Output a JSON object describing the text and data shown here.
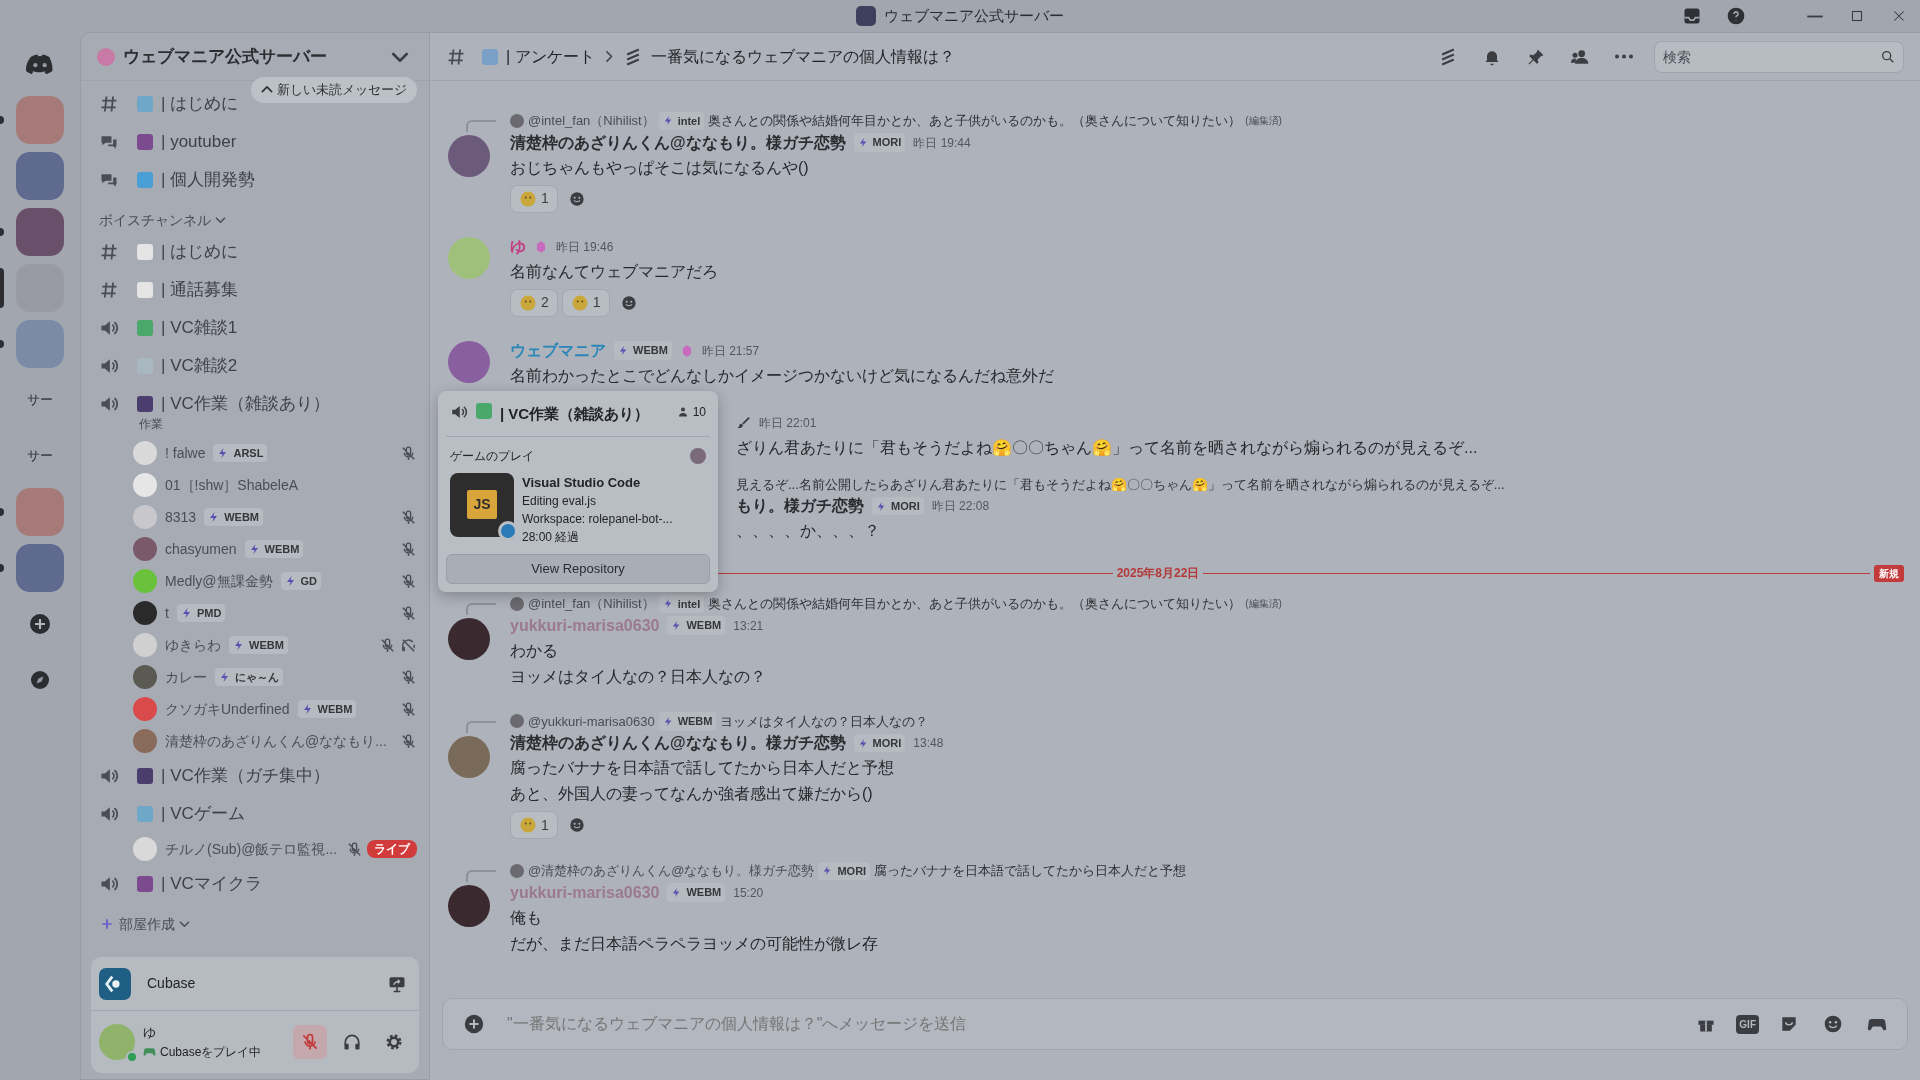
{
  "window": {
    "title": "ウェブマニア公式サーバー"
  },
  "servers": [
    {
      "kind": "home",
      "unread": false,
      "selected": false
    },
    {
      "kind": "guild",
      "unread": true,
      "selected": false
    },
    {
      "kind": "guild",
      "unread": false,
      "selected": false
    },
    {
      "kind": "guild",
      "unread": true,
      "selected": false
    },
    {
      "kind": "guild",
      "unread": false,
      "selected": true
    },
    {
      "kind": "guild",
      "unread": true,
      "selected": false
    },
    {
      "kind": "named",
      "label": "サー",
      "unread": false,
      "selected": false
    },
    {
      "kind": "named",
      "label": "サー",
      "unread": false,
      "selected": false
    },
    {
      "kind": "guild",
      "unread": true,
      "selected": false
    },
    {
      "kind": "guild",
      "unread": true,
      "selected": false
    },
    {
      "kind": "add",
      "unread": false,
      "selected": false
    },
    {
      "kind": "discover",
      "unread": false,
      "selected": false
    }
  ],
  "server": {
    "name": "ウェブマニア公式サーバー"
  },
  "unread_banner": "新しい未読メッセージ",
  "channels": [
    {
      "kind": "text",
      "name": "| はじめに"
    },
    {
      "kind": "forum",
      "name": "| youtuber"
    },
    {
      "kind": "forum",
      "name": "| 個人開発勢"
    },
    {
      "kind": "category",
      "name": "ボイスチャンネル",
      "expanded": true
    },
    {
      "kind": "text",
      "name": "| はじめに"
    },
    {
      "kind": "text",
      "name": "| 通話募集"
    },
    {
      "kind": "voice",
      "name": "| VC雑談1"
    },
    {
      "kind": "voice",
      "name": "| VC雑談2"
    },
    {
      "kind": "voice",
      "name": "| VC作業（雑談あり）",
      "status": "作業",
      "members": [
        {
          "name": "! falwe",
          "tag": "ARSL",
          "muted": true,
          "deafened": false
        },
        {
          "name": "01［!shw］ShabeleA",
          "muted": false,
          "deafened": false
        },
        {
          "name": "8313",
          "tag": "WEBM",
          "muted": true,
          "deafened": false
        },
        {
          "name": "chasyumen",
          "tag": "WEBM",
          "muted": true,
          "deafened": false
        },
        {
          "name": "Medly@無課金勢",
          "tag": "GD",
          "muted": true,
          "deafened": false
        },
        {
          "name": "t",
          "tag": "PMD",
          "muted": true,
          "deafened": false
        },
        {
          "name": "ゆきらわ",
          "tag": "WEBM",
          "muted": true,
          "deafened": true
        },
        {
          "name": "カレー",
          "tag": "にゃ～ん",
          "muted": true,
          "deafened": false
        },
        {
          "name": "クソガキUnderfined",
          "tag": "WEBM",
          "muted": true,
          "deafened": false
        },
        {
          "name": "清楚枠のあざりんくん@ななもり...",
          "muted": true,
          "deafened": false
        }
      ]
    },
    {
      "kind": "voice",
      "name": "| VC作業（ガチ集中）"
    },
    {
      "kind": "voice",
      "name": "| VCゲーム",
      "members": [
        {
          "name": "チルノ(Sub)@飯テロ監視...",
          "muted": true,
          "deafened": false,
          "live": "ライブ"
        }
      ]
    },
    {
      "kind": "voice",
      "name": "| VCマイクラ"
    },
    {
      "kind": "create",
      "name": "部屋作成",
      "expanded": true
    }
  ],
  "activity": {
    "name": "Cubase"
  },
  "user": {
    "name": "ゆ",
    "status": "Cubaseをプレイ中",
    "online": true,
    "muted": true,
    "deafened": false
  },
  "header": {
    "channel": "| アンケート",
    "thread": "一番気になるウェブマニアの個人情報は？",
    "search": {
      "placeholder": "検索"
    }
  },
  "messages": [
    {
      "kind": "normal",
      "reply": {
        "author": "@intel_fan（Nihilist）",
        "tag": "intel",
        "text": "奥さんとの関係や結婚何年目かとか、あと子供がいるのかも。（奥さんについて知りたい）",
        "edited": "(編集済)"
      },
      "author": "清楚枠のあざりんくん@ななもり。様ガチ恋勢",
      "color": "#2b2d31",
      "tag": "MORI",
      "boost": false,
      "time": "昨日 19:44",
      "lines": [
        "おじちゃんもやっぱそこは気になるんや()"
      ],
      "reactions": [
        {
          "count": "1"
        }
      ]
    },
    {
      "kind": "normal",
      "author": "ゆ",
      "color": "#c23f86",
      "boost": true,
      "time": "昨日 19:46",
      "lines": [
        "名前なんてウェブマニアだろ"
      ],
      "reactions": [
        {
          "count": "2"
        },
        {
          "count": "1"
        }
      ]
    },
    {
      "kind": "normal",
      "author": "ウェブマニア",
      "color": "#2a86b8",
      "tag": "WEBM",
      "boost": true,
      "time": "昨日 21:57",
      "lines": [
        "名前わかったとこでどんなしかイメージつかないけど気になるんだね意外だ"
      ]
    },
    {
      "kind": "occluded",
      "time": "昨日 22:01",
      "lines": [
        "ざりん君あたりに「君もそうだよね🤗〇〇ちゃん🤗」って名前を晒されながら煽られるのが見えるぞ..."
      ]
    },
    {
      "kind": "occluded",
      "reply": {
        "text": "見えるぞ...名前公開したらあざりん君あたりに「君もそうだよね🤗〇〇ちゃん🤗」って名前を晒されながら煽られるのが見えるぞ..."
      },
      "author": "もり。様ガチ恋勢",
      "color": "#2b2d31",
      "tag": "MORI",
      "time": "昨日 22:08",
      "lines": [
        "、、、、か、、、？"
      ]
    },
    {
      "kind": "divider",
      "text": "2025年8月22日",
      "badge": "新規"
    },
    {
      "kind": "normal",
      "reply": {
        "author": "@intel_fan（Nihilist）",
        "tag": "intel",
        "text": "奥さんとの関係や結婚何年目かとか、あと子供がいるのかも。（奥さんについて知りたい）",
        "edited": "(編集済)"
      },
      "author": "yukkuri-marisa0630",
      "color": "#9b7a8e",
      "tag": "WEBM",
      "boost": false,
      "time": "13:21",
      "lines": [
        "わかる",
        "ヨッメはタイ人なの？日本人なの？"
      ]
    },
    {
      "kind": "normal",
      "reply": {
        "author": "@yukkuri-marisa0630",
        "tag": "WEBM",
        "text": "ヨッメはタイ人なの？日本人なの？"
      },
      "author": "清楚枠のあざりんくん@ななもり。様ガチ恋勢",
      "color": "#2b2d31",
      "tag": "MORI",
      "boost": false,
      "time": "13:48",
      "lines": [
        "腐ったバナナを日本語で話してたから日本人だと予想",
        "あと、外国人の妻ってなんか強者感出て嫌だから()"
      ],
      "reactions": [
        {
          "count": "1"
        }
      ]
    },
    {
      "kind": "normal",
      "reply": {
        "author": "@清楚枠のあざりんくん@ななもり。様ガチ恋勢",
        "tag": "MORI",
        "text": "腐ったバナナを日本語で話してたから日本人だと予想"
      },
      "author": "yukkuri-marisa0630",
      "color": "#9b7a8e",
      "tag": "WEBM",
      "boost": false,
      "time": "15:20",
      "lines": [
        "俺も",
        "だが、まだ日本語ペラペラヨッメの可能性が微レ存"
      ]
    }
  ],
  "popup": {
    "channel": "| VC作業（雑談あり）",
    "count": "10",
    "section": "ゲームのプレイ",
    "app": {
      "name": "Visual Studio Code",
      "icon_text": "JS",
      "lines": [
        "Editing eval.js",
        "Workspace: rolepanel-bot-...",
        "28:00 経過"
      ]
    },
    "button": "View Repository"
  },
  "composer": {
    "placeholder": "\"一番気になるウェブマニアの個人情報は？\"へメッセージを送信",
    "gif": "GIF"
  }
}
